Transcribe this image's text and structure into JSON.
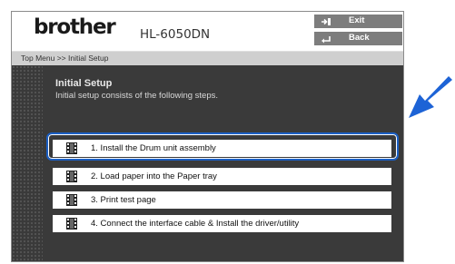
{
  "header": {
    "logo": "brother",
    "model": "HL-6050DN"
  },
  "nav": {
    "exit_label": "Exit",
    "back_label": "Back"
  },
  "breadcrumb": {
    "root": "Top Menu",
    "separator": ">>",
    "current": "Initial Setup"
  },
  "main": {
    "title": "Initial Setup",
    "subtitle": "Initial setup consists of the following steps."
  },
  "steps": [
    "1. Install the Drum unit assembly",
    "2. Load paper into the Paper tray",
    "3. Print test page",
    "4. Connect the interface cable & Install the driver/utility"
  ],
  "colors": {
    "content_bg": "#3a3a3a",
    "highlight": "#1b5fc4",
    "arrow": "#1d63d6",
    "nav_button": "#7d7d7d"
  }
}
